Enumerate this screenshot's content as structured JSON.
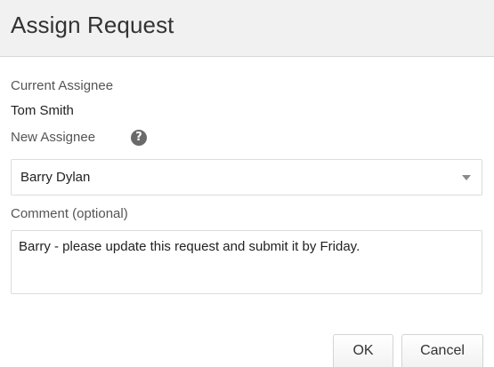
{
  "dialog": {
    "title": "Assign Request"
  },
  "current_assignee": {
    "label": "Current Assignee",
    "value": "Tom Smith"
  },
  "new_assignee": {
    "label": "New Assignee",
    "help_icon": "?",
    "selected_value": "Barry Dylan"
  },
  "comment": {
    "label": "Comment (optional)",
    "value": "Barry - please update this request and submit it by Friday."
  },
  "buttons": {
    "ok_label": "OK",
    "cancel_label": "Cancel"
  }
}
